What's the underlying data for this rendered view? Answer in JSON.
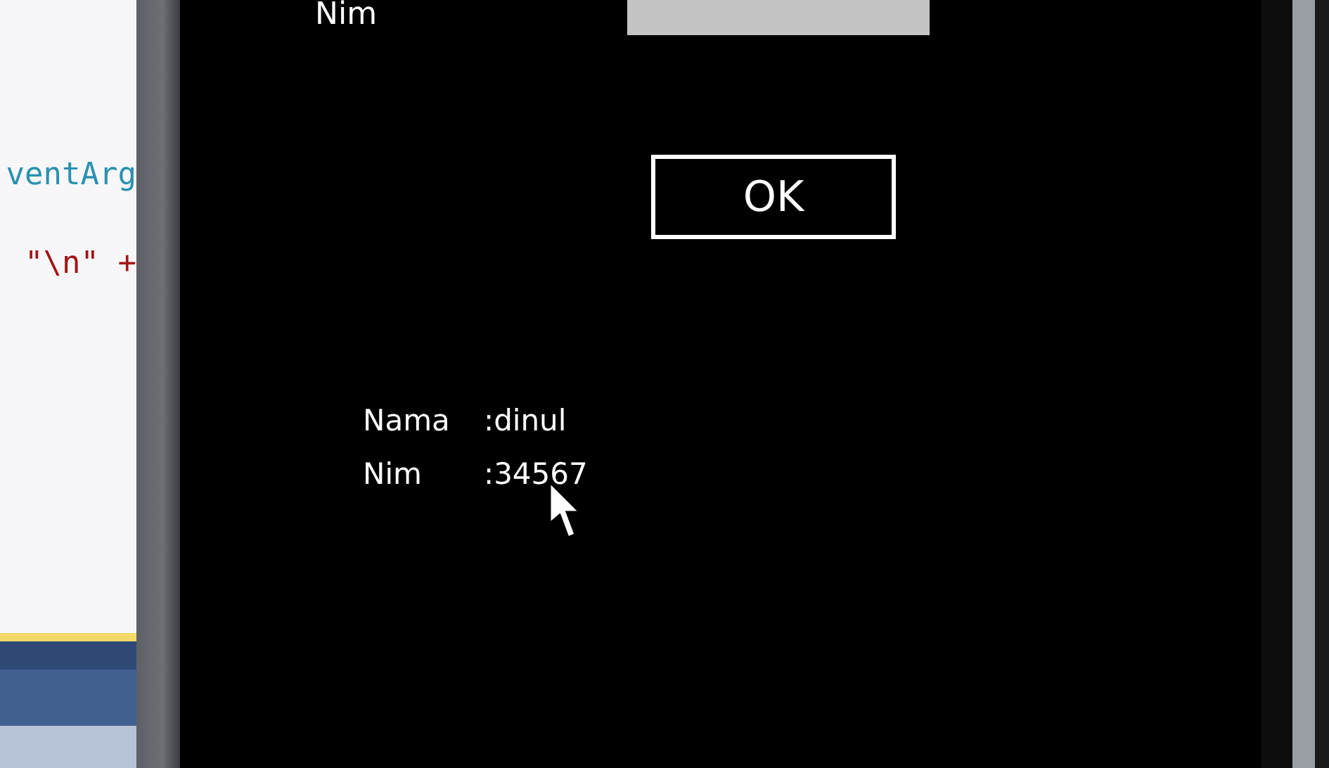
{
  "editor": {
    "code_lines": [
      {
        "text": "ventArg",
        "kind": "type"
      },
      {
        "text": "\"\\n\" +",
        "kind": "string"
      }
    ]
  },
  "phone": {
    "nim_field": {
      "label": "Nim"
    },
    "ok_button": {
      "label": "OK"
    },
    "result": [
      {
        "label": "Nama",
        "value": ":dinul"
      },
      {
        "label": "Nim",
        "value": ":34567"
      }
    ]
  }
}
